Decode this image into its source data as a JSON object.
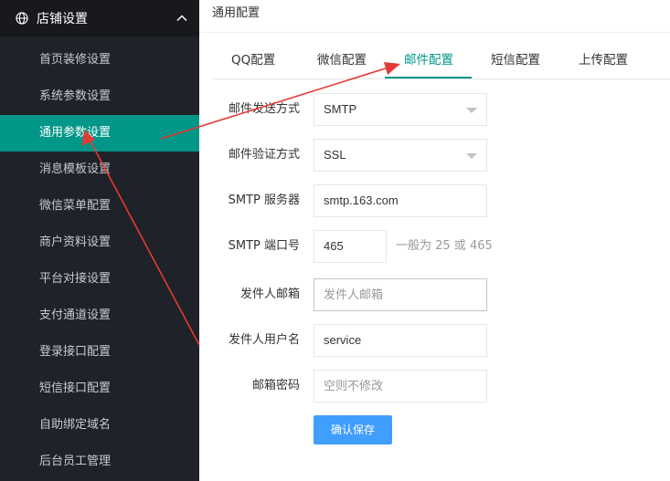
{
  "sidebar": {
    "title": "店铺设置",
    "items": [
      {
        "label": "首页装修设置",
        "active": false
      },
      {
        "label": "系统参数设置",
        "active": false
      },
      {
        "label": "通用参数设置",
        "active": true
      },
      {
        "label": "消息模板设置",
        "active": false
      },
      {
        "label": "微信菜单配置",
        "active": false
      },
      {
        "label": "商户资料设置",
        "active": false
      },
      {
        "label": "平台对接设置",
        "active": false
      },
      {
        "label": "支付通道设置",
        "active": false
      },
      {
        "label": "登录接口配置",
        "active": false
      },
      {
        "label": "短信接口配置",
        "active": false
      },
      {
        "label": "自助绑定域名",
        "active": false
      },
      {
        "label": "后台员工管理",
        "active": false
      }
    ]
  },
  "breadcrumb": "通用配置",
  "tabs": [
    {
      "label": "QQ配置"
    },
    {
      "label": "微信配置"
    },
    {
      "label": "邮件配置",
      "active": true
    },
    {
      "label": "短信配置"
    },
    {
      "label": "上传配置"
    }
  ],
  "form": {
    "send_method": {
      "label": "邮件发送方式",
      "value": "SMTP"
    },
    "auth_method": {
      "label": "邮件验证方式",
      "value": "SSL"
    },
    "smtp_server": {
      "label": "SMTP 服务器",
      "value": "smtp.163.com"
    },
    "smtp_port": {
      "label": "SMTP 端口号",
      "value": "465",
      "hint": "一般为 25 或 465"
    },
    "sender_email": {
      "label": "发件人邮箱",
      "value": "",
      "placeholder": "发件人邮箱"
    },
    "sender_username": {
      "label": "发件人用户名",
      "value": "service"
    },
    "mail_password": {
      "label": "邮箱密码",
      "value": "",
      "placeholder": "空则不修改"
    },
    "submit_label": "确认保存"
  },
  "colors": {
    "sidebar_bg": "#1f2228",
    "accent": "#009688",
    "button": "#409eff",
    "annotation_arrow": "#e53935"
  }
}
